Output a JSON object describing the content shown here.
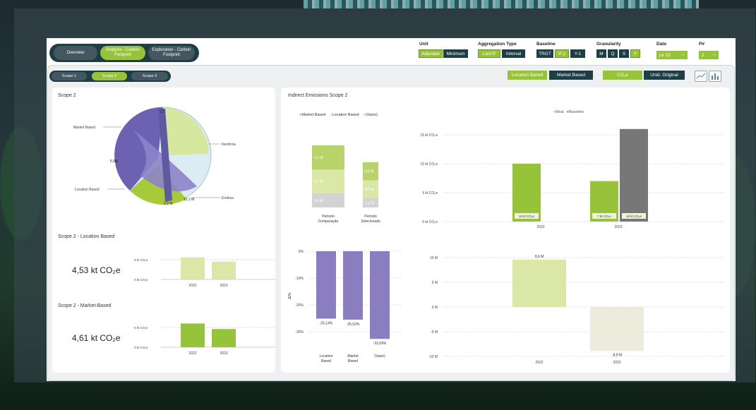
{
  "nav": {
    "overview": "Overview",
    "analysis": "Analysis - Carbon Footprint",
    "exploration": "Exploration - Carbon Footprint"
  },
  "controls": {
    "unit": {
      "label": "Unit",
      "options": [
        "Adjusted",
        "Minimum"
      ]
    },
    "aggregation": {
      "label": "Aggregation Type",
      "options": [
        "Last P",
        "Interval"
      ]
    },
    "baseline": {
      "label": "Baseline",
      "options": [
        "TRGT",
        "P-1",
        "Y-1"
      ]
    },
    "granularity": {
      "label": "Granularity",
      "options": [
        "M",
        "Q",
        "S",
        "Y"
      ]
    },
    "date": {
      "label": "Date",
      "value": "jul 23"
    },
    "p": {
      "label": "P#",
      "value": "2"
    }
  },
  "scopes": [
    "Scope 1",
    "Scope 2",
    "Scope 3"
  ],
  "toggles": {
    "location": "Location Based",
    "market": "Market Based",
    "co2e": "CO₂e",
    "unid": "Unid. Original"
  },
  "left": {
    "scope2_title": "Scope 2",
    "chord_labels": {
      "market": "Market Based",
      "location": "Location Based",
      "iberdrola": "Iberdrola",
      "endesa": "Endesa",
      "v1": "2,2",
      "v2": "6,9M",
      "v3": "12,2 M",
      "v4": "2,2 M"
    },
    "loc_title": "Scope 2 - Location Based",
    "loc_kpi": "4,53 kt CO₂e",
    "mkt_title": "Scope 2 - Market-Based",
    "mkt_kpi": "4,61 kt CO₂e",
    "ytick_top": "5 kt CO₂e",
    "ytick_bottom": "0 kt CO₂e"
  },
  "right": {
    "title": "Indirect Emissions Scope 2",
    "legend1": [
      "Market Based",
      "Location Based",
      "(Vazio)"
    ],
    "legend2": [
      "Real",
      "Baseline"
    ]
  },
  "chart_data": [
    {
      "type": "bar",
      "title": "Scope 2 - Location Based",
      "categories": [
        "2022",
        "2023"
      ],
      "values": [
        5.6,
        4.5
      ],
      "ylim": [
        0,
        7
      ]
    },
    {
      "type": "bar",
      "title": "Scope 2 - Market-Based",
      "categories": [
        "2022",
        "2023"
      ],
      "values": [
        6.0,
        4.6
      ],
      "ylim": [
        0,
        7
      ]
    },
    {
      "type": "bar",
      "subtype": "stacked",
      "categories": [
        "Período Comparação",
        "Período Selecionado"
      ],
      "series": [
        {
          "name": "(Vazio)",
          "values": [
            3.6,
            2.4
          ]
        },
        {
          "name": "Location Based",
          "values": [
            6.0,
            4.5
          ]
        },
        {
          "name": "Market Based",
          "values": [
            6.2,
            4.6
          ]
        }
      ],
      "data_labels": [
        "6,2 M",
        "6,0 M",
        "3,6 M",
        "4,6 M",
        "4,5 M",
        "2,4 M"
      ]
    },
    {
      "type": "bar",
      "categories": [
        "Location Based",
        "Market Based",
        "(Vazio)"
      ],
      "values": [
        -25.14,
        -25.52,
        -32.69
      ],
      "ylabel": "Δ%",
      "yticks": [
        "0%",
        "-10%",
        "-20%",
        "-30%"
      ],
      "data_labels": [
        "-25,14%",
        "-25,52%",
        "-32,69%"
      ]
    },
    {
      "type": "bar",
      "categories": [
        "2022",
        "2023"
      ],
      "series": [
        {
          "name": "Real",
          "values": [
            10,
            7
          ]
        },
        {
          "name": "Baseline",
          "values": [
            null,
            16
          ]
        }
      ],
      "yticks": [
        "15 kt CO₂e",
        "10 kt CO₂e",
        "5 kt CO₂e",
        "0 kt CO₂e"
      ],
      "data_labels": [
        "10 kt CO₂e",
        "7 kt CO₂e",
        "16 kt CO₂e"
      ]
    },
    {
      "type": "bar",
      "categories": [
        "2022",
        "2023"
      ],
      "values": [
        9.6,
        -8.9
      ],
      "yticks": [
        "10 M",
        "5 M",
        "0 M",
        "-5 M",
        "-10 M"
      ],
      "data_labels": [
        "9,6 M",
        "-8,9 M"
      ]
    }
  ],
  "colors": {
    "green": "#97c33b",
    "light_green": "#dbe7a6",
    "dark": "#1e3e45",
    "purple": "#8b7ec0",
    "grey": "#777777",
    "pale": "#ecebdc"
  }
}
